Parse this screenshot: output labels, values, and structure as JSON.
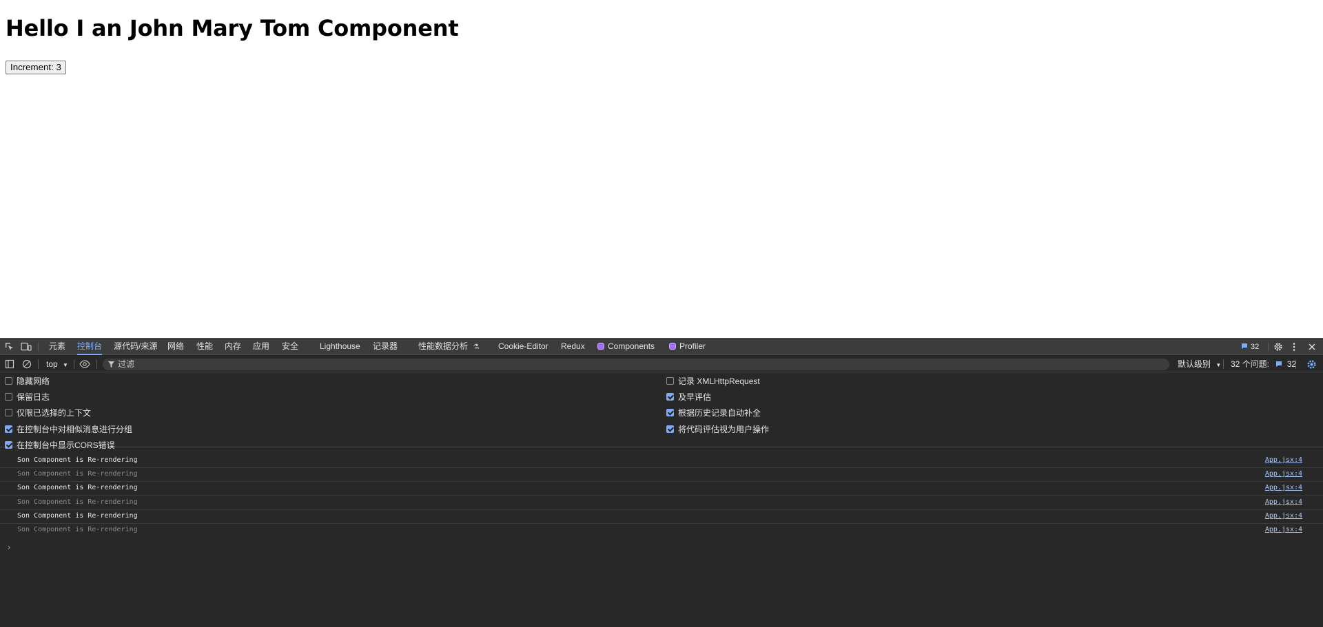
{
  "page": {
    "heading": "Hello I an John Mary Tom Component",
    "button_label": "Increment: 3"
  },
  "devtools": {
    "tabs": [
      {
        "label": "元素"
      },
      {
        "label": "控制台"
      },
      {
        "label": "源代码/来源"
      },
      {
        "label": "网络"
      },
      {
        "label": "性能"
      },
      {
        "label": "内存"
      },
      {
        "label": "应用"
      },
      {
        "label": "安全"
      },
      {
        "label": "Lighthouse"
      },
      {
        "label": "记录器"
      },
      {
        "label": "性能数据分析"
      },
      {
        "label": "Cookie-Editor"
      },
      {
        "label": "Redux"
      },
      {
        "label": "Components"
      },
      {
        "label": "Profiler"
      }
    ],
    "active_tab": "控制台",
    "message_count": "32",
    "toolbar": {
      "context": "top",
      "filter_placeholder": "过滤",
      "level": "默认级别",
      "issues_label": "32 个问题:",
      "issues_count": "32"
    },
    "settings": {
      "left": [
        {
          "label": "隐藏网络",
          "checked": false
        },
        {
          "label": "保留日志",
          "checked": false
        },
        {
          "label": "仅限已选择的上下文",
          "checked": false
        },
        {
          "label": "在控制台中对相似消息进行分组",
          "checked": true
        },
        {
          "label": "在控制台中显示CORS错误",
          "checked": true
        }
      ],
      "right": [
        {
          "label": "记录 XMLHttpRequest",
          "checked": false
        },
        {
          "label": "及早评估",
          "checked": true
        },
        {
          "label": "根据历史记录自动补全",
          "checked": true
        },
        {
          "label": "将代码评估视为用户操作",
          "checked": true
        }
      ]
    },
    "logs": [
      {
        "message": "Son Component is Re-rendering",
        "source": "App.jsx:4",
        "dim": false
      },
      {
        "message": "Son Component is Re-rendering",
        "source": "App.jsx:4",
        "dim": true
      },
      {
        "message": "Son Component is Re-rendering",
        "source": "App.jsx:4",
        "dim": false
      },
      {
        "message": "Son Component is Re-rendering",
        "source": "App.jsx:4",
        "dim": true
      },
      {
        "message": "Son Component is Re-rendering",
        "source": "App.jsx:4",
        "dim": false
      },
      {
        "message": "Son Component is Re-rendering",
        "source": "App.jsx:4",
        "dim": true
      }
    ],
    "prompt_symbol": "›",
    "colors": {
      "panel_bg": "#282828",
      "tabbar_bg": "#3c3c3c",
      "accent": "#7cacf8",
      "text": "#e3e3e3",
      "dim_text": "#8a8a8a",
      "link": "#a8c7fa"
    }
  }
}
